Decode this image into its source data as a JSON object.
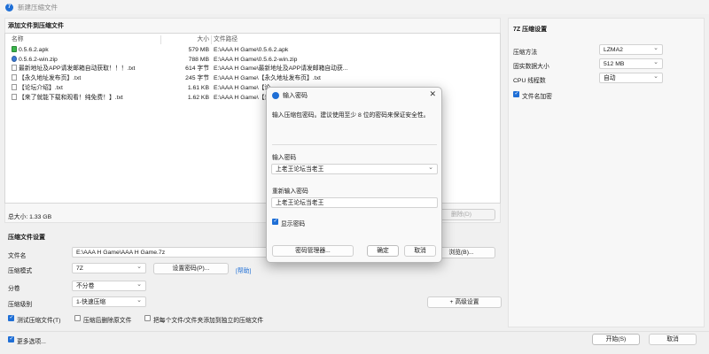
{
  "window": {
    "title": "新建压缩文件",
    "icon_glyph": "7"
  },
  "files_section": {
    "heading": "添加文件到压缩文件",
    "columns": {
      "name": "名称",
      "size": "大小",
      "path": "文件路径"
    },
    "rows": [
      {
        "icon": "apk-icon",
        "name": "0.5.6.2.apk",
        "size": "579 MB",
        "path": "E:\\AAA H Game\\0.5.6.2.apk"
      },
      {
        "icon": "zip-icon",
        "name": "0.5.6.2-win.zip",
        "size": "788 MB",
        "path": "E:\\AAA H Game\\0.5.6.2-win.zip"
      },
      {
        "icon": "txt-icon",
        "name": "最新地址及APP请发邮箱自动获取！！！.txt",
        "size": "614 字节",
        "path": "E:\\AAA H Game\\最新地址及APP请发邮箱自动获..."
      },
      {
        "icon": "txt-icon",
        "name": "【永久地址发布页】.txt",
        "size": "245 字节",
        "path": "E:\\AAA H Game\\【永久地址发布页】.txt"
      },
      {
        "icon": "txt-icon",
        "name": "【论坛介绍】.txt",
        "size": "1.61 KB",
        "path": "E:\\AAA H Game\\【论..."
      },
      {
        "icon": "txt-icon",
        "name": "【来了就能下载和观看！纯免费！】.txt",
        "size": "1.62 KB",
        "path": "E:\\AAA H Game\\【来..."
      }
    ],
    "total_size": "总大小: 1.33 GB",
    "delete_button": "删除(D)"
  },
  "compression_settings": {
    "heading": "压缩文件设置",
    "filename_label": "文件名",
    "filename_value": "E:\\AAA H Game\\AAA H Game.7z",
    "browse_button": "浏览(B)...",
    "mode_label": "压缩模式",
    "mode_value": "7Z",
    "set_password_button": "设置密码(P)...",
    "help_link": "[帮助]",
    "split_label": "分卷",
    "split_value": "不分卷",
    "level_label": "压缩级别",
    "level_value": "1-快速压缩",
    "advanced_button": "+ 高级设置",
    "test_archive": "测试压缩文件(T)",
    "delete_after": "压缩后删除原文件",
    "separate_archives": "把每个文件/文件夹添加到独立的压缩文件"
  },
  "right_panel": {
    "heading": "7Z 压缩设置",
    "method_label": "压缩方法",
    "method_value": "LZMA2",
    "dict_label": "固实数据大小",
    "dict_value": "512 MB",
    "threads_label": "CPU 线程数",
    "threads_value": "自动",
    "encrypt_names": "文件名加密"
  },
  "bottom": {
    "more_options": "更多选项...",
    "start_button": "开始(S)",
    "cancel_button": "取消"
  },
  "password_dialog": {
    "title": "输入密码",
    "instruction": "输入压缩包密码。建议使用至少 8 位的密码来保证安全性。",
    "enter_label": "输入密码",
    "enter_value": "上老王论坛当老王",
    "reenter_label": "重新输入密码",
    "reenter_value": "上老王论坛当老王",
    "show_password": "显示密码",
    "manager_button": "密码管理器...",
    "ok_button": "确定",
    "cancel_button": "取消"
  }
}
